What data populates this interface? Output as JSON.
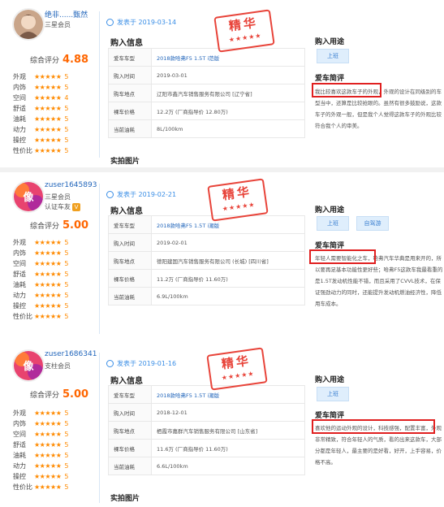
{
  "labels": {
    "score": "综合评分",
    "posted": "发表于",
    "buy_info": "购入信息",
    "photos": "实拍图片",
    "purpose": "购入用途",
    "favorite": "爱车简评",
    "stamp": "精华",
    "stamp_stars": "★★★★★",
    "stars": "★★★★★",
    "keys": [
      "爱车车型",
      "购入时间",
      "购车地点",
      "裸车价格",
      "当前油耗"
    ]
  },
  "colors": {
    "accent": "#3a8ee6",
    "score": "#ff6600",
    "star": "#ff8a00",
    "stamp": "#e8443a",
    "highlight": "#e02020"
  },
  "reviews": [
    {
      "user": {
        "name": "绝非......甄然",
        "level": "三星会员",
        "badge": "",
        "score": "4.88",
        "ratings": [
          {
            "label": "外观",
            "value": "5"
          },
          {
            "label": "内饰",
            "value": "5"
          },
          {
            "label": "空间",
            "value": "4"
          },
          {
            "label": "舒适",
            "value": "5"
          },
          {
            "label": "油耗",
            "value": "5"
          },
          {
            "label": "动力",
            "value": "5"
          },
          {
            "label": "操控",
            "value": "5"
          },
          {
            "label": "性价比",
            "value": "5"
          }
        ]
      },
      "date": "2019-03-14",
      "info": [
        "2018款哈弗F5 1.5T i范版",
        "2019-03-01",
        "辽阳市鑫汽车销售服务有限公司 [辽宁省]",
        "12.2万 (厂商指导价 12.80万)",
        "8L/100km"
      ],
      "purposes": [
        "上班"
      ],
      "favorite": "我比较喜欢这款车子的外观，外观的设计在同级别的车型当中，还算是比较抢眼的。虽然有很多鼓励说，这款车子的外观一般，但是我个人觉得这款车子的外观比较符合我个人的审美。"
    },
    {
      "user": {
        "name": "zuser1645893",
        "level": "三星会员",
        "badge": "认证车友",
        "score": "5.00",
        "ratings": [
          {
            "label": "外观",
            "value": "5"
          },
          {
            "label": "内饰",
            "value": "5"
          },
          {
            "label": "空间",
            "value": "5"
          },
          {
            "label": "舒适",
            "value": "5"
          },
          {
            "label": "油耗",
            "value": "5"
          },
          {
            "label": "动力",
            "value": "5"
          },
          {
            "label": "操控",
            "value": "5"
          },
          {
            "label": "性价比",
            "value": "5"
          }
        ]
      },
      "date": "2019-02-21",
      "info": [
        "2018款哈弗F5 1.5T i潮版",
        "2019-02-01",
        "德阳建国汽车销售服务有限公司 (长城) [四川省]",
        "11.2万 (厂商指导价 11.60万)",
        "6.9L/100km"
      ],
      "purposes": [
        "上班",
        "自驾游"
      ],
      "favorite": "年轻人需要智能化之车，哈弗汽车华典是用来开的，所以要再足基本功能性更好些；哈弗F5这款车我最看重的是1.5T发动机性能不错，而且采用了CVVL技术，在保证强劲动力的同时，还能提升发动机燃油经济性，降低用车成本。"
    },
    {
      "user": {
        "name": "zuser1686341",
        "level": "支柱会员",
        "badge": "",
        "score": "5.00",
        "ratings": [
          {
            "label": "外观",
            "value": "5"
          },
          {
            "label": "内饰",
            "value": "5"
          },
          {
            "label": "空间",
            "value": "5"
          },
          {
            "label": "舒适",
            "value": "5"
          },
          {
            "label": "油耗",
            "value": "5"
          },
          {
            "label": "动力",
            "value": "5"
          },
          {
            "label": "操控",
            "value": "5"
          },
          {
            "label": "性价比",
            "value": "5"
          }
        ]
      },
      "date": "2019-01-16",
      "info": [
        "2018款哈弗F5 1.5T i潮版",
        "2018-12-01",
        "栖霞市嘉群汽车销售服务有限公司 [山东省]",
        "11.6万 (厂商指导价 11.60万)",
        "6.6L/100km"
      ],
      "purposes": [
        "上班"
      ],
      "favorite": "喜欢他的运动外观的设计，科技感强，配置丰富，外观非常精致，符合年轻人的气质，看的出来这款车，大部分都是年轻人，最主要的是好看，好开，上手容易，价格不高。"
    }
  ]
}
